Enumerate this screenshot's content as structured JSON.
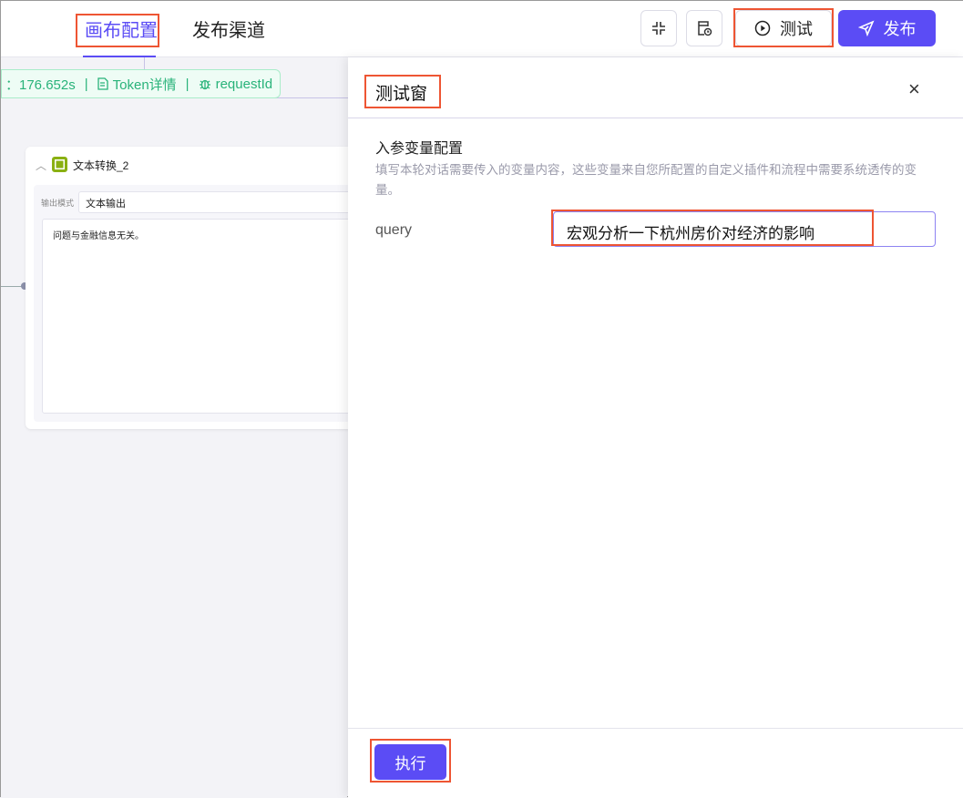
{
  "header": {
    "tabs": [
      {
        "label": "画布配置",
        "active": true
      },
      {
        "label": "发布渠道",
        "active": false
      }
    ],
    "test_label": "测试",
    "publish_label": "发布",
    "accent": "#5b4cf5"
  },
  "runbar": {
    "duration": "：176.652s",
    "token_label": "Token详情",
    "request_label": "requestId"
  },
  "node": {
    "title": "文本转换_2",
    "mode_label": "输出模式",
    "mode_value": "文本输出",
    "content": "问题与金融信息无关。"
  },
  "panel": {
    "title": "测试窗",
    "section_title": "入参变量配置",
    "description": "填写本轮对话需要传入的变量内容，这些变量来自您所配置的自定义插件和流程中需要系统透传的变量。",
    "var_name": "query",
    "var_value": "宏观分析一下杭州房价对经济的影响",
    "run_label": "执行"
  }
}
